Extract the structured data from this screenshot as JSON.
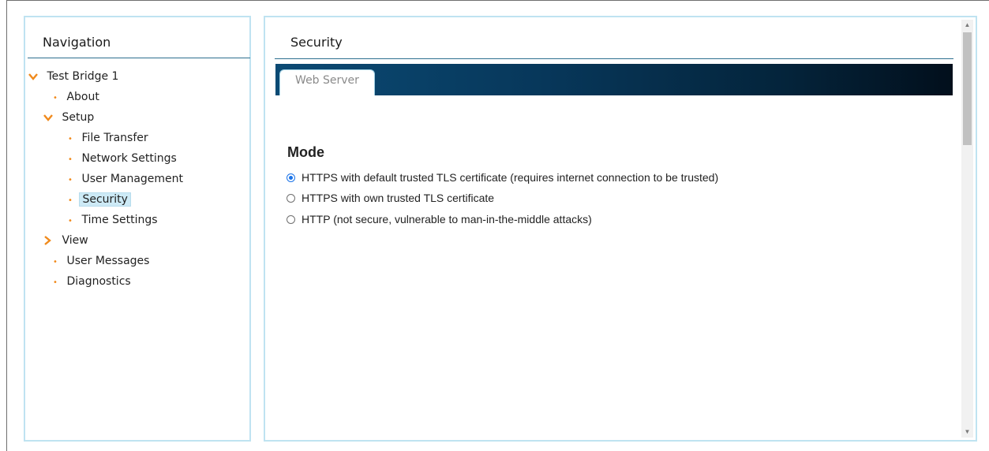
{
  "navigation": {
    "title": "Navigation",
    "items": [
      {
        "label": "Test Bridge 1",
        "marker": "chevron-down"
      },
      {
        "label": "About",
        "marker": "bullet"
      },
      {
        "label": "Setup",
        "marker": "chevron-down"
      },
      {
        "label": "File Transfer",
        "marker": "bullet"
      },
      {
        "label": "Network Settings",
        "marker": "bullet"
      },
      {
        "label": "User Management",
        "marker": "bullet"
      },
      {
        "label": "Security",
        "marker": "bullet",
        "selected": true
      },
      {
        "label": "Time Settings",
        "marker": "bullet"
      },
      {
        "label": "View",
        "marker": "chevron-right"
      },
      {
        "label": "User Messages",
        "marker": "bullet"
      },
      {
        "label": "Diagnostics",
        "marker": "bullet"
      }
    ]
  },
  "content": {
    "title": "Security",
    "tabs": [
      {
        "label": "Web Server",
        "active": true
      }
    ],
    "section_heading": "Mode",
    "options": [
      {
        "label": "HTTPS with default trusted TLS certificate (requires internet connection to be trusted)",
        "checked": true
      },
      {
        "label": "HTTPS with own trusted TLS certificate",
        "checked": false
      },
      {
        "label": "HTTP (not secure, vulnerable to man-in-the-middle attacks)",
        "checked": false
      }
    ]
  },
  "colors": {
    "accent_orange": "#f08a1c",
    "panel_border": "#bfe3f1",
    "selection_bg": "#cdeaf6",
    "tab_bar_dark": "#04243b",
    "radio_checked": "#1a73e8"
  }
}
